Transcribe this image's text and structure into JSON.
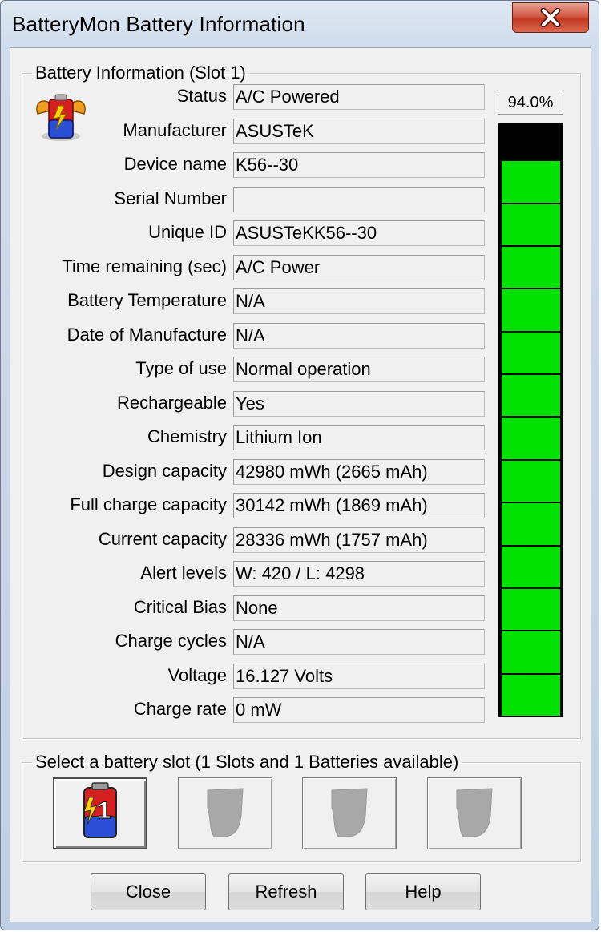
{
  "window": {
    "title": "BatteryMon Battery Information"
  },
  "info_group": {
    "legend": "Battery Information (Slot 1)",
    "percent": "94.0%",
    "charge_fraction": 0.94,
    "rows": [
      {
        "label": "Status",
        "value": "A/C Powered"
      },
      {
        "label": "Manufacturer",
        "value": "ASUSTeK"
      },
      {
        "label": "Device name",
        "value": "K56--30"
      },
      {
        "label": "Serial Number",
        "value": ""
      },
      {
        "label": "Unique ID",
        "value": " ASUSTeKK56--30"
      },
      {
        "label": "Time remaining (sec)",
        "value": "A/C Power"
      },
      {
        "label": "Battery Temperature",
        "value": "N/A"
      },
      {
        "label": "Date of Manufacture",
        "value": "N/A"
      },
      {
        "label": "Type of use",
        "value": "Normal operation"
      },
      {
        "label": "Rechargeable",
        "value": "Yes"
      },
      {
        "label": "Chemistry",
        "value": "Lithium Ion"
      },
      {
        "label": "Design capacity",
        "value": "42980 mWh (2665 mAh)"
      },
      {
        "label": "Full charge capacity",
        "value": "30142 mWh (1869 mAh)"
      },
      {
        "label": "Current capacity",
        "value": "28336 mWh (1757 mAh)"
      },
      {
        "label": "Alert levels",
        "value": "W: 420 / L: 4298"
      },
      {
        "label": "Critical Bias",
        "value": "None"
      },
      {
        "label": "Charge cycles",
        "value": "N/A"
      },
      {
        "label": "Voltage",
        "value": "16.127 Volts"
      },
      {
        "label": "Charge rate",
        "value": "0 mW"
      }
    ]
  },
  "slot_group": {
    "legend": "Select a battery slot (1 Slots and 1 Batteries available)",
    "slots": [
      {
        "label": "1",
        "active": true
      },
      {
        "label": "",
        "active": false
      },
      {
        "label": "",
        "active": false
      },
      {
        "label": "",
        "active": false
      }
    ]
  },
  "buttons": {
    "close": "Close",
    "refresh": "Refresh",
    "help": "Help"
  },
  "colors": {
    "meter_fill": "#00e100",
    "meter_empty": "#000000",
    "close_button": "#c2381f"
  }
}
